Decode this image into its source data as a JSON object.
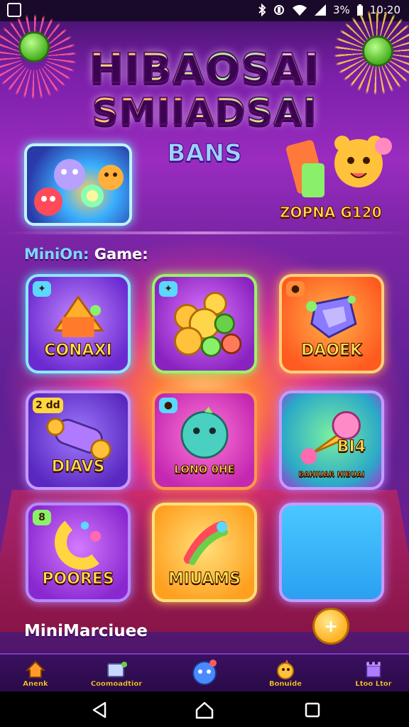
{
  "status_bar": {
    "battery": "3%",
    "time": "10:20"
  },
  "header": {
    "title_line1": "HIBAOSAI",
    "title_line2": "SMIIADSAI",
    "subtitle": "BANS",
    "promo_label": "ZOPNA G120"
  },
  "sections": {
    "minigames_title_accent": "MiniOn:",
    "minigames_title_rest": " Game:",
    "bottom_title": "MiniMarciuee"
  },
  "tiles": [
    {
      "label": "CONAXI",
      "badge": ""
    },
    {
      "label": "",
      "badge": ""
    },
    {
      "label": "DAOEK",
      "badge": ""
    },
    {
      "label": "DIAVS",
      "badge": "2 dd"
    },
    {
      "label": "LONO 0HE",
      "badge": ""
    },
    {
      "label": "BI4",
      "badge": ""
    },
    {
      "label": "POORES",
      "badge": "8"
    },
    {
      "label": "MIUAMS",
      "badge": ""
    },
    {
      "label": "",
      "badge": ""
    }
  ],
  "tile6_caption": "BAHIUAR HIBUAI",
  "bottom_nav": {
    "items": [
      {
        "label": "Anenk",
        "icon": "home-icon"
      },
      {
        "label": "Coomoadtior",
        "icon": "box-icon"
      },
      {
        "label": "",
        "icon": "mascot-icon"
      },
      {
        "label": "Bonuide",
        "icon": "chick-icon"
      },
      {
        "label": "Ltoo Ltor",
        "icon": "castle-icon"
      }
    ]
  },
  "colors": {
    "accent_gold": "#ffd640",
    "accent_blue": "#7ad8ff",
    "background_purple": "#7a1fa8"
  }
}
